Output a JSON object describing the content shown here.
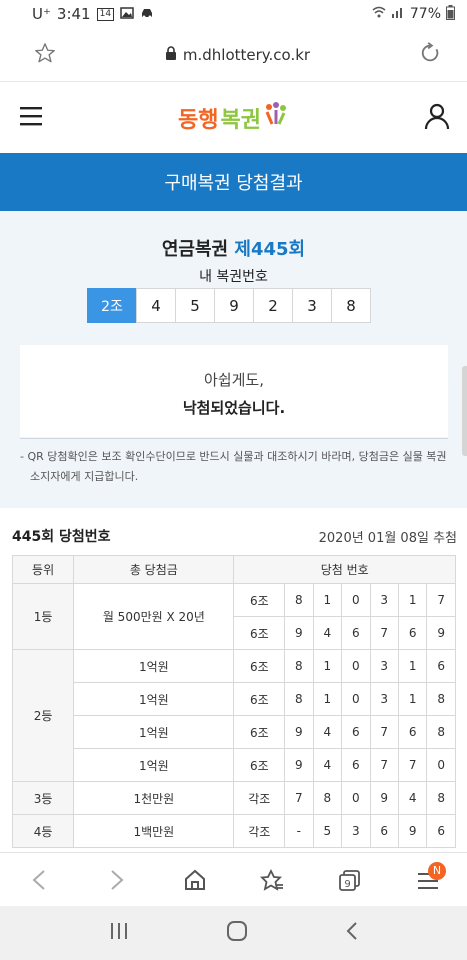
{
  "status": {
    "carrier": "U⁺",
    "time": "3:41",
    "badge": "14",
    "battery": "77%"
  },
  "browser": {
    "url": "m.dhlottery.co.kr"
  },
  "logo": {
    "part1": "동행",
    "part2": "복권",
    "sub": "dong hang lottery"
  },
  "banner": {
    "title": "구매복권 당첨결과"
  },
  "result": {
    "lottery_name": "연금복권",
    "round_label": "제445회",
    "my_ticket_label": "내 복권번호",
    "group": "2조",
    "digits": [
      "4",
      "5",
      "9",
      "2",
      "3",
      "8"
    ],
    "message_line1": "아쉽게도,",
    "message_line2": "낙첨되었습니다.",
    "notice": "- QR 당첨확인은 보조 확인수단이므로 반드시 실물과 대조하시기 바라며, 당첨금은 실물 복권소지자에게 지급합니다."
  },
  "winning": {
    "title": "445회 당첨번호",
    "date": "2020년 01월 08일 추첨",
    "headers": [
      "등위",
      "총 당첨금",
      "당첨 번호"
    ],
    "rows": [
      {
        "rank": "1등",
        "prize": "월 500만원 X 20년",
        "group": "6조",
        "digits": [
          "8",
          "1",
          "0",
          "3",
          "1",
          "7"
        ]
      },
      {
        "group": "6조",
        "digits": [
          "9",
          "4",
          "6",
          "7",
          "6",
          "9"
        ]
      },
      {
        "rank": "2등",
        "prize": "1억원",
        "group": "6조",
        "digits": [
          "8",
          "1",
          "0",
          "3",
          "1",
          "6"
        ]
      },
      {
        "prize": "1억원",
        "group": "6조",
        "digits": [
          "8",
          "1",
          "0",
          "3",
          "1",
          "8"
        ]
      },
      {
        "prize": "1억원",
        "group": "6조",
        "digits": [
          "9",
          "4",
          "6",
          "7",
          "6",
          "8"
        ]
      },
      {
        "prize": "1억원",
        "group": "6조",
        "digits": [
          "9",
          "4",
          "6",
          "7",
          "7",
          "0"
        ]
      },
      {
        "rank": "3등",
        "prize": "1천만원",
        "group": "각조",
        "digits": [
          "7",
          "8",
          "0",
          "9",
          "4",
          "8"
        ]
      },
      {
        "rank": "4등",
        "prize": "1백만원",
        "group": "각조",
        "digits": [
          "-",
          "5",
          "3",
          "6",
          "9",
          "6"
        ]
      }
    ]
  },
  "tabs_badge": "N",
  "colors": {
    "primary": "#1a79c4",
    "group_badge": "#3b95e5",
    "accent": "#f26522"
  }
}
